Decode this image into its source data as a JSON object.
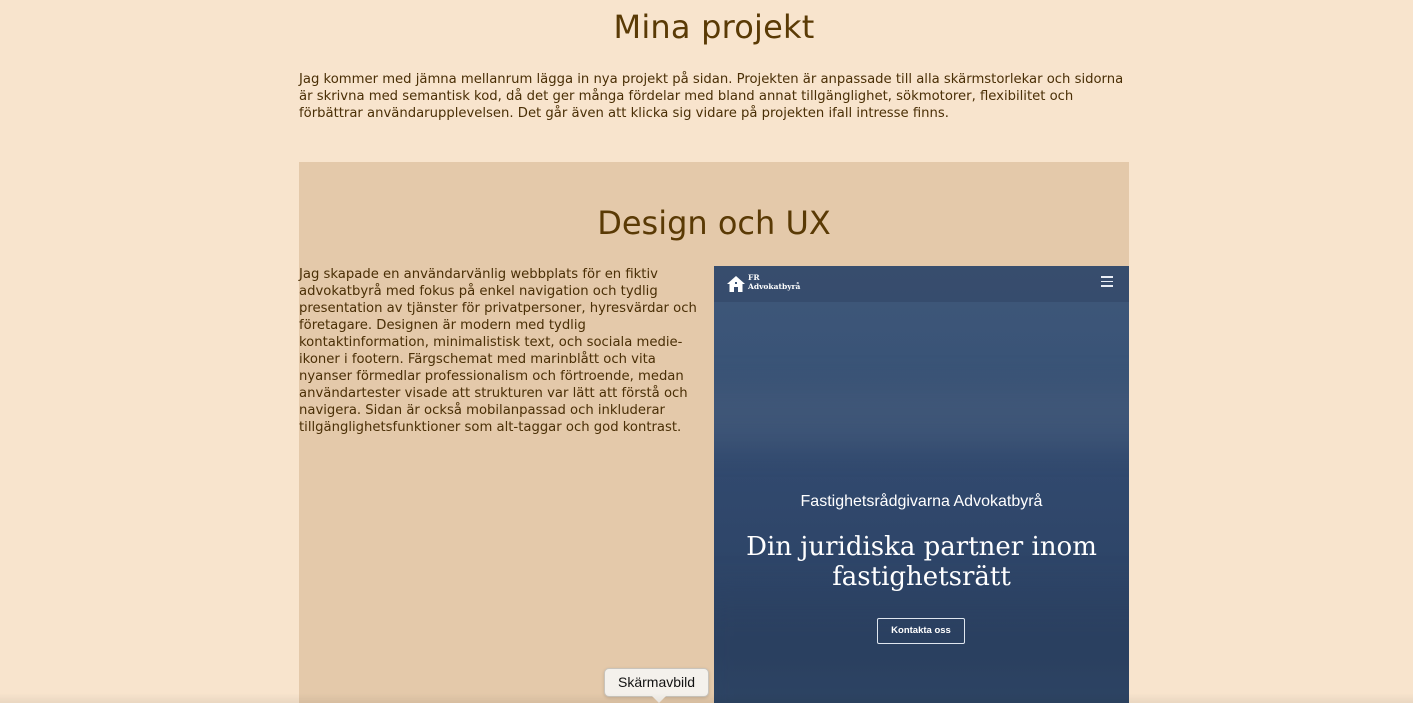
{
  "page": {
    "title": "Mina projekt",
    "intro": "Jag kommer med jämna mellanrum lägga in nya projekt på sidan. Projekten är anpassade till alla skärmstorlekar och sidorna är skrivna med semantisk kod, då det ger många fördelar med bland annat tillgänglighet, sökmotorer, flexibilitet och förbättrar användarupplevelsen. Det går även att klicka sig vidare på projekten ifall intresse finns."
  },
  "project": {
    "title": "Design och UX",
    "description": "Jag skapade en användarvänlig webbplats för en fiktiv advokatbyrå med fokus på enkel navigation och tydlig presentation av tjänster för privatpersoner, hyresvärdar och företagare. Designen är modern med tydlig kontaktinformation, minimalistisk text, och sociala medie-ikoner i footern. Färgschemat med marinblått och vita nyanser förmedlar professionalism och förtroende, medan användartester visade att strukturen var lätt att förstå och navigera. Sidan är också mobilanpassad och inkluderar tillgänglighetsfunktioner som alt-taggar och god kontrast.",
    "screenshot": {
      "brand_line1": "FR",
      "brand_line2": "Advokatbyrå",
      "logo_icon": "house-icon",
      "menu_icon": "hamburger-menu-icon",
      "subtitle": "Fastighetsrådgivarna Advokatbyrå",
      "headline": "Din juridiska partner inom fastighetsrätt",
      "button": "Kontakta oss"
    }
  },
  "tooltip": {
    "text": "Skärmavbild"
  },
  "colors": {
    "background": "#f8e4cd",
    "card": "#e4c9aa",
    "heading": "#5a3a05",
    "text": "#4a2f06",
    "screenshot_navy": "#31496e"
  }
}
